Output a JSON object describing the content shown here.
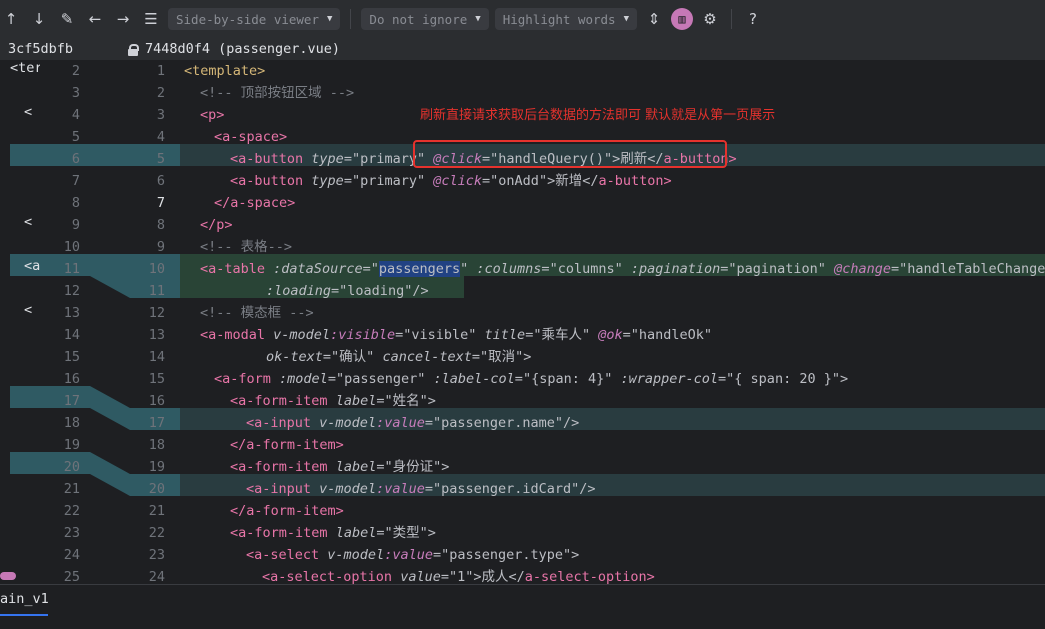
{
  "toolbar": {
    "viewer_mode": "Side-by-side viewer",
    "ignore_mode": "Do not ignore",
    "highlight_mode": "Highlight words",
    "help": "?"
  },
  "headers": {
    "left_revision": "3cf5dbfb",
    "right_revision": "7448d0f4 (passenger.vue)"
  },
  "annotation": "刷新直接请求获取后台数据的方法即可 默认就是从第一页展示",
  "gutter": {
    "left_numbers": [
      "2",
      "3",
      "4",
      "5",
      "6",
      "7",
      "8",
      "9",
      "10",
      "11",
      "12",
      "13",
      "14",
      "15",
      "16",
      "17",
      "18",
      "19",
      "20",
      "21",
      "22",
      "23",
      "24",
      "25"
    ],
    "right_numbers": [
      "1",
      "2",
      "3",
      "4",
      "5",
      "6",
      "7",
      "8",
      "9",
      "10",
      "11",
      "12",
      "13",
      "14",
      "15",
      "16",
      "17",
      "18",
      "19",
      "20",
      "21",
      "22",
      "23",
      "24"
    ]
  },
  "left_pane_snippets": [
    "<ter",
    "<",
    "<",
    "<",
    "<a"
  ],
  "code": {
    "l1_tag": "<template>",
    "l2_comment": "<!-- 顶部按钮区域 -->",
    "l3_tag": "<p>",
    "l4_tag": "<a-space>",
    "l5_open": "<a-button",
    "l5_attr1": "type",
    "l5_val1": "\"primary\"",
    "l5_event": "@click",
    "l5_val2": "\"handleQuery()\"",
    "l5_text": ">刷新</",
    "l5_close": "a-button>",
    "l6_open": "<a-button",
    "l6_attr1": "type",
    "l6_val1": "\"primary\"",
    "l6_event": "@click",
    "l6_val2": "\"onAdd\"",
    "l6_text": ">新增</",
    "l6_close": "a-button>",
    "l7_tag": "</a-space>",
    "l8_tag": "</p>",
    "l9_comment": "<!-- 表格-->",
    "l10_open": "<a-table",
    "l10_attr1": ":dataSource",
    "l10_val1": "passengers",
    "l10_attr2": ":columns",
    "l10_val2": "\"columns\"",
    "l10_attr3": ":pagination",
    "l10_val3": "\"pagination\"",
    "l10_event": "@change",
    "l10_val4": "\"handleTableChange\"",
    "l11_attr": ":loading",
    "l11_val": "\"loading\"/>",
    "l12_comment": "<!-- 模态框 -->",
    "l13_open": "<a-modal",
    "l13_vmodel": "v-model",
    "l13_arg": ":visible",
    "l13_val1": "\"visible\"",
    "l13_attr2": "title",
    "l13_val2": "\"乘车人\"",
    "l13_event": "@ok",
    "l13_val3": "\"handleOk\"",
    "l14_attr1": "ok-text",
    "l14_val1": "\"确认\"",
    "l14_attr2": "cancel-text",
    "l14_val2": "\"取消\">",
    "l15_open": "<a-form",
    "l15_attr1": ":model",
    "l15_val1": "\"passenger\"",
    "l15_attr2": ":label-col",
    "l15_val2": "\"{span: 4}\"",
    "l15_attr3": ":wrapper-col",
    "l15_val3": "\"{ span: 20 }\">",
    "l16_open": "<a-form-item",
    "l16_attr": "label",
    "l16_val": "\"姓名\">",
    "l17_open": "<a-input",
    "l17_vmodel": "v-model",
    "l17_arg": ":value",
    "l17_val": "\"passenger.name\"/>",
    "l18_tag": "</a-form-item>",
    "l19_open": "<a-form-item",
    "l19_attr": "label",
    "l19_val": "\"身份证\">",
    "l20_open": "<a-input",
    "l20_vmodel": "v-model",
    "l20_arg": ":value",
    "l20_val": "\"passenger.idCard\"/>",
    "l21_tag": "</a-form-item>",
    "l22_open": "<a-form-item",
    "l22_attr": "label",
    "l22_val": "\"类型\">",
    "l23_open": "<a-select",
    "l23_vmodel": "v-model",
    "l23_arg": ":value",
    "l23_val": "\"passenger.type\">",
    "l24_open": "<a-select-option",
    "l24_attr": "value",
    "l24_val": "\"1\"",
    "l24_text": ">成人</",
    "l24_close": "a-select-option>"
  },
  "bottom": {
    "branch": "ain_v1"
  },
  "colors": {
    "accent": "#c678b6",
    "diff_band": "#2f5a63",
    "annotation": "#e5322d"
  }
}
